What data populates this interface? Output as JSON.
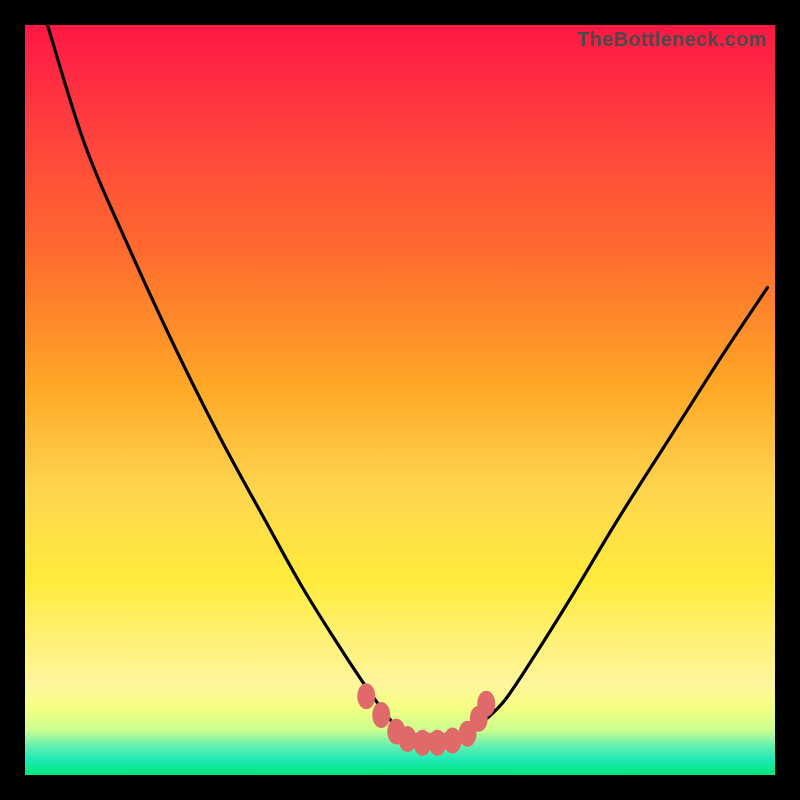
{
  "watermark": "TheBottleneck.com",
  "chart_data": {
    "type": "line",
    "title": "",
    "xlabel": "",
    "ylabel": "",
    "xlim": [
      0,
      100
    ],
    "ylim": [
      0,
      100
    ],
    "gradient_stops": [
      {
        "offset": 0.0,
        "color": "#ff1744"
      },
      {
        "offset": 0.12,
        "color": "#ff3b3f"
      },
      {
        "offset": 0.3,
        "color": "#ff6a2f"
      },
      {
        "offset": 0.48,
        "color": "#ffa726"
      },
      {
        "offset": 0.62,
        "color": "#ffd54f"
      },
      {
        "offset": 0.74,
        "color": "#ffeb3b"
      },
      {
        "offset": 0.82,
        "color": "#fff176"
      },
      {
        "offset": 0.88,
        "color": "#fff59d"
      },
      {
        "offset": 0.91,
        "color": "#f4ff81"
      },
      {
        "offset": 0.94,
        "color": "#ccff90"
      },
      {
        "offset": 0.96,
        "color": "#69f0ae"
      },
      {
        "offset": 0.98,
        "color": "#1de9b6"
      },
      {
        "offset": 1.0,
        "color": "#00e676"
      }
    ],
    "series": [
      {
        "name": "bottleneck-curve",
        "type": "line",
        "x": [
          3,
          8,
          14,
          20,
          26,
          32,
          37,
          42,
          46,
          49,
          51,
          53,
          55,
          57,
          59,
          61,
          64,
          68,
          73,
          79,
          86,
          93,
          99
        ],
        "y": [
          100,
          84,
          70,
          57,
          45,
          34,
          25,
          17,
          11,
          7,
          5,
          4,
          4,
          4,
          5,
          7,
          10,
          16,
          24,
          34,
          45,
          56,
          65
        ]
      },
      {
        "name": "marker-cluster",
        "type": "scatter",
        "color": "#e06a6a",
        "x": [
          45.5,
          47.5,
          49.5,
          51.0,
          53.0,
          55.0,
          57.0,
          59.0,
          60.5,
          61.5
        ],
        "y": [
          10.5,
          8.0,
          5.8,
          4.8,
          4.3,
          4.3,
          4.6,
          5.5,
          7.5,
          9.5
        ]
      }
    ]
  }
}
